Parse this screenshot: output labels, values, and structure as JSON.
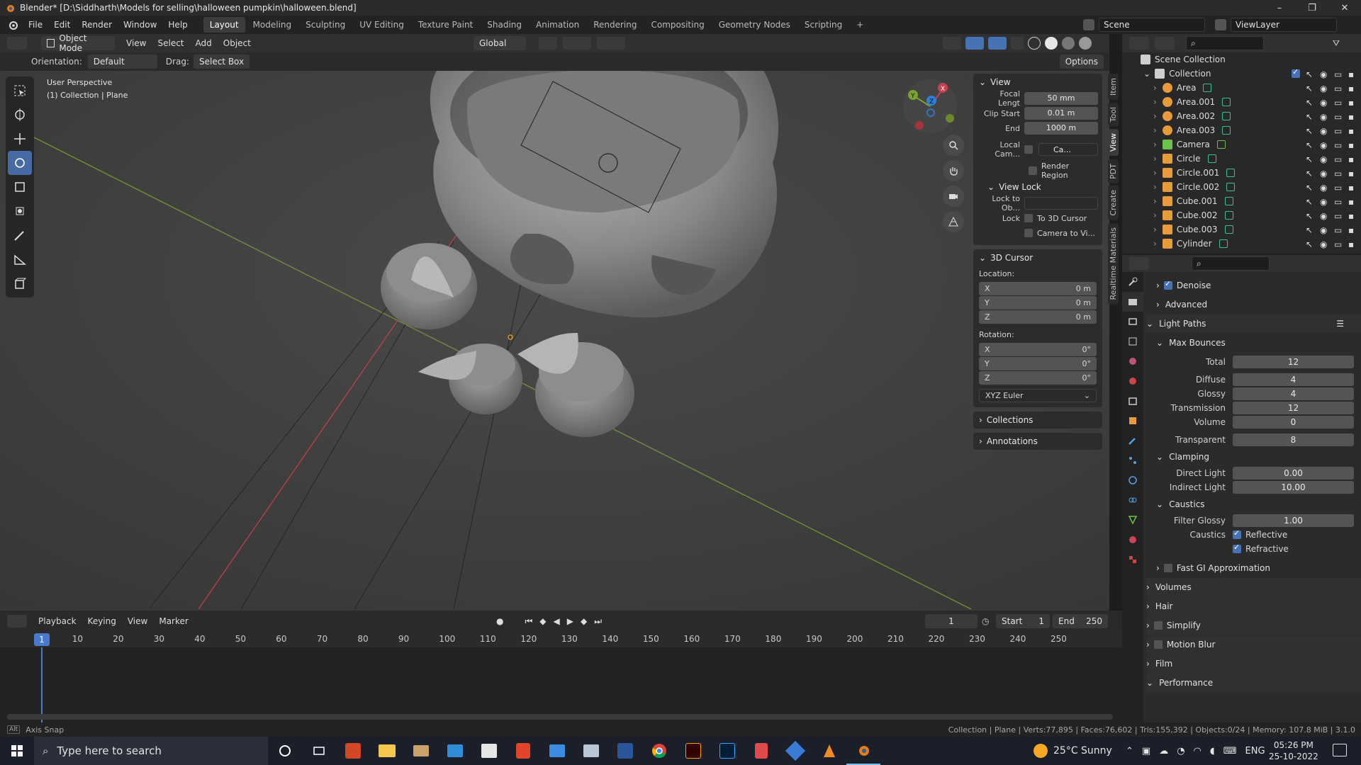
{
  "window": {
    "title": "Blender* [D:\\Siddharth\\Models for selling\\halloween pumpkin\\halloween.blend]"
  },
  "menu": [
    "File",
    "Edit",
    "Render",
    "Window",
    "Help"
  ],
  "workspaces": [
    "Layout",
    "Modeling",
    "Sculpting",
    "UV Editing",
    "Texture Paint",
    "Shading",
    "Animation",
    "Rendering",
    "Compositing",
    "Geometry Nodes",
    "Scripting"
  ],
  "scene": {
    "scene_name": "Scene",
    "view_layer": "ViewLayer"
  },
  "viewport_header": {
    "mode": "Object Mode",
    "menus": [
      "View",
      "Select",
      "Add",
      "Object"
    ],
    "transform": "Global"
  },
  "tool_settings": {
    "orientation_label": "Orientation:",
    "orientation": "Default",
    "drag_label": "Drag:",
    "drag": "Select Box",
    "options": "Options"
  },
  "viewport": {
    "line1": "User Perspective",
    "line2": "(1) Collection | Plane"
  },
  "npanel": {
    "view": {
      "title": "View",
      "focal_label": "Focal Lengt",
      "focal": "50 mm",
      "clip_start_label": "Clip Start",
      "clip_start": "0.01 m",
      "clip_end_label": "End",
      "clip_end": "1000 m",
      "local_cam_label": "Local Cam...",
      "local_cam_value": "Ca...",
      "render_region": "Render Region",
      "view_lock": "View Lock",
      "lock_to_label": "Lock to Ob...",
      "lock_label": "Lock",
      "to_cursor": "To 3D Cursor",
      "cam_to_view": "Camera to Vi..."
    },
    "cursor": {
      "title": "3D Cursor",
      "location_label": "Location:",
      "rotation_label": "Rotation:",
      "loc": [
        {
          "axis": "X",
          "val": "0 m"
        },
        {
          "axis": "Y",
          "val": "0 m"
        },
        {
          "axis": "Z",
          "val": "0 m"
        }
      ],
      "rot": [
        {
          "axis": "X",
          "val": "0°"
        },
        {
          "axis": "Y",
          "val": "0°"
        },
        {
          "axis": "Z",
          "val": "0°"
        }
      ],
      "mode": "XYZ Euler"
    },
    "collections": "Collections",
    "annotations": "Annotations",
    "tabs": [
      "Item",
      "Tool",
      "View",
      "PDT",
      "Create",
      "Realtime Materials"
    ]
  },
  "outliner": {
    "scene_collection": "Scene Collection",
    "collection": "Collection",
    "items": [
      {
        "name": "Area",
        "kind": "light"
      },
      {
        "name": "Area.001",
        "kind": "light"
      },
      {
        "name": "Area.002",
        "kind": "light"
      },
      {
        "name": "Area.003",
        "kind": "light"
      },
      {
        "name": "Camera",
        "kind": "camera"
      },
      {
        "name": "Circle",
        "kind": "mesh"
      },
      {
        "name": "Circle.001",
        "kind": "mesh"
      },
      {
        "name": "Circle.002",
        "kind": "mesh"
      },
      {
        "name": "Cube.001",
        "kind": "mesh"
      },
      {
        "name": "Cube.002",
        "kind": "mesh"
      },
      {
        "name": "Cube.003",
        "kind": "mesh"
      },
      {
        "name": "Cylinder",
        "kind": "mesh"
      }
    ]
  },
  "properties": {
    "denoise": "Denoise",
    "advanced": "Advanced",
    "light_paths": "Light Paths",
    "max_bounces": "Max Bounces",
    "bounces": [
      {
        "label": "Total",
        "value": "12"
      },
      {
        "label": "Diffuse",
        "value": "4"
      },
      {
        "label": "Glossy",
        "value": "4"
      },
      {
        "label": "Transmission",
        "value": "12"
      },
      {
        "label": "Volume",
        "value": "0"
      },
      {
        "label": "Transparent",
        "value": "8"
      }
    ],
    "clamping": "Clamping",
    "clamp": [
      {
        "label": "Direct Light",
        "value": "0.00"
      },
      {
        "label": "Indirect Light",
        "value": "10.00"
      }
    ],
    "caustics": "Caustics",
    "filter_glossy_label": "Filter Glossy",
    "filter_glossy": "1.00",
    "caustics_label": "Caustics",
    "reflective": "Reflective",
    "refractive": "Refractive",
    "fast_gi": "Fast GI Approximation",
    "sections": [
      "Volumes",
      "Hair",
      "Simplify",
      "Motion Blur",
      "Film",
      "Performance"
    ]
  },
  "timeline": {
    "menus": [
      "Playback",
      "Keying",
      "View",
      "Marker"
    ],
    "current_frame": "1",
    "start_label": "Start",
    "start": "1",
    "end_label": "End",
    "end": "250",
    "ticks": [
      "10",
      "20",
      "30",
      "40",
      "50",
      "60",
      "70",
      "80",
      "90",
      "100",
      "110",
      "120",
      "130",
      "140",
      "150",
      "160",
      "170",
      "180",
      "190",
      "200",
      "210",
      "220",
      "230",
      "240",
      "250"
    ],
    "cursor_frame": "1"
  },
  "statusbar": {
    "left": "Axis Snap",
    "right": "Collection | Plane | Verts:77,895 | Faces:76,602 | Tris:155,392 | Objects:0/24 | Memory: 107.8 MiB | 3.1.0"
  },
  "taskbar": {
    "search_placeholder": "Type here to search",
    "weather": "25°C  Sunny",
    "lang": "ENG",
    "time": "05:26 PM",
    "date": "25-10-2022"
  },
  "colors": {
    "accent": "#4772b3",
    "axis_x": "#c6424e",
    "axis_y": "#7ba233",
    "axis_z": "#2f7fd6"
  }
}
